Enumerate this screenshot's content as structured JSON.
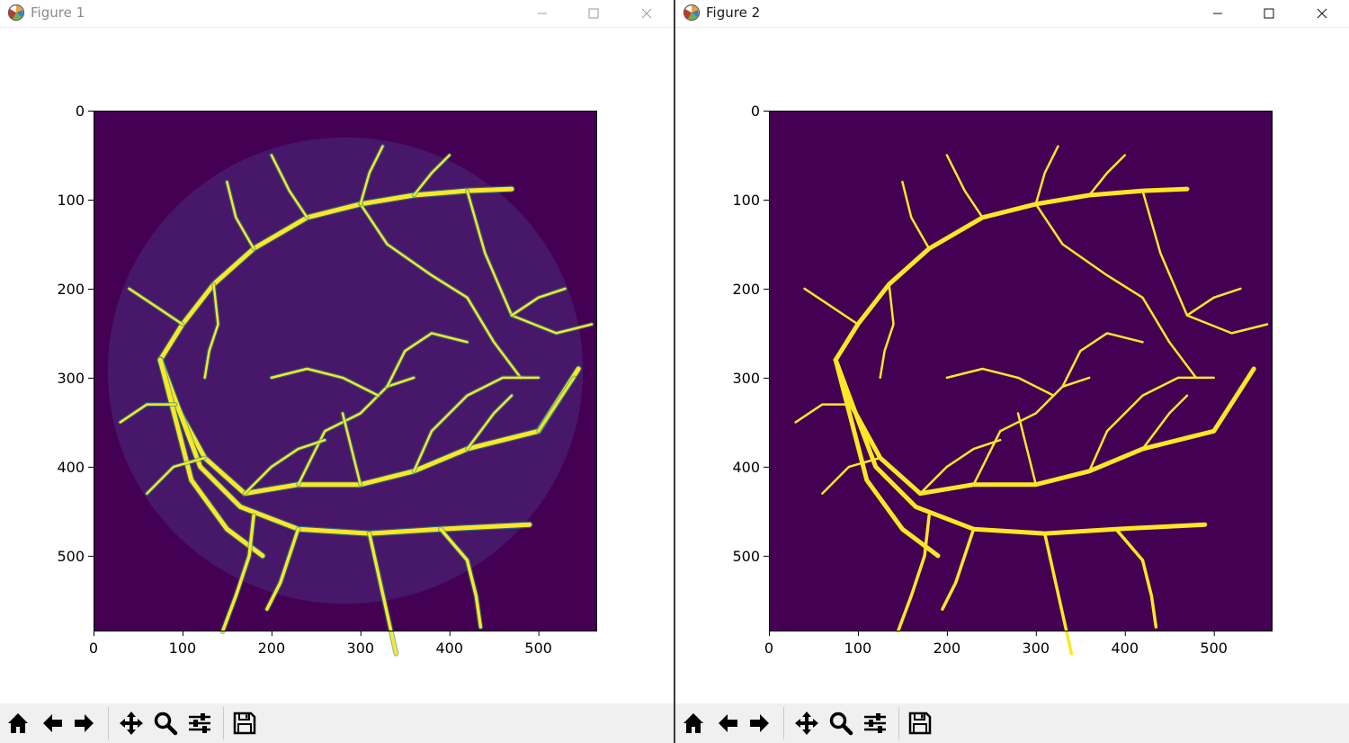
{
  "windows": [
    {
      "title": "Figure 1",
      "image_style": "probability-map",
      "chart_data": {
        "type": "heatmap",
        "title": "",
        "xlabel": "",
        "ylabel": "",
        "image_shape": [
          584,
          565
        ],
        "xlim": [
          0,
          565
        ],
        "ylim": [
          584,
          0
        ],
        "xticks": [
          0,
          100,
          200,
          300,
          400,
          500
        ],
        "yticks": [
          0,
          100,
          200,
          300,
          400,
          500
        ],
        "colormap": "viridis",
        "colors": {
          "background": "#440154",
          "mid": "#21918c",
          "high": "#fde725"
        }
      }
    },
    {
      "title": "Figure 2",
      "image_style": "binary-mask",
      "chart_data": {
        "type": "heatmap",
        "title": "",
        "xlabel": "",
        "ylabel": "",
        "image_shape": [
          584,
          565
        ],
        "xlim": [
          0,
          565
        ],
        "ylim": [
          584,
          0
        ],
        "xticks": [
          0,
          100,
          200,
          300,
          400,
          500
        ],
        "yticks": [
          0,
          100,
          200,
          300,
          400,
          500
        ],
        "colormap": "viridis",
        "colors": {
          "background": "#440154",
          "high": "#fde725"
        }
      }
    }
  ],
  "window_controls": [
    "minimize-icon",
    "maximize-icon",
    "close-icon"
  ],
  "toolbar_buttons": [
    {
      "name": "home-icon",
      "tooltip": "Reset original view"
    },
    {
      "name": "back-arrow-icon",
      "tooltip": "Back to previous view"
    },
    {
      "name": "forward-arrow-icon",
      "tooltip": "Forward to next view"
    },
    {
      "name": "pan-move-icon",
      "tooltip": "Pan axes"
    },
    {
      "name": "zoom-magnifier-icon",
      "tooltip": "Zoom to rectangle"
    },
    {
      "name": "configure-subplots-icon",
      "tooltip": "Configure subplots"
    },
    {
      "name": "save-floppy-icon",
      "tooltip": "Save the figure"
    }
  ],
  "vessels": [
    [
      [
        75,
        280
      ],
      [
        100,
        240
      ],
      [
        135,
        195
      ],
      [
        180,
        155
      ],
      [
        240,
        120
      ],
      [
        300,
        105
      ],
      [
        360,
        95
      ],
      [
        420,
        90
      ],
      [
        470,
        88
      ]
    ],
    [
      [
        75,
        280
      ],
      [
        92,
        330
      ],
      [
        125,
        390
      ],
      [
        170,
        430
      ],
      [
        230,
        420
      ],
      [
        300,
        420
      ],
      [
        360,
        405
      ],
      [
        420,
        380
      ],
      [
        500,
        360
      ],
      [
        545,
        290
      ]
    ],
    [
      [
        75,
        280
      ],
      [
        120,
        400
      ],
      [
        165,
        445
      ],
      [
        230,
        470
      ],
      [
        310,
        475
      ],
      [
        390,
        470
      ],
      [
        490,
        465
      ]
    ],
    [
      [
        75,
        280
      ],
      [
        110,
        415
      ],
      [
        150,
        470
      ],
      [
        190,
        500
      ]
    ],
    [
      [
        180,
        455
      ],
      [
        175,
        500
      ],
      [
        160,
        545
      ],
      [
        145,
        585
      ]
    ],
    [
      [
        230,
        470
      ],
      [
        210,
        530
      ],
      [
        195,
        560
      ]
    ],
    [
      [
        390,
        470
      ],
      [
        420,
        505
      ],
      [
        430,
        545
      ],
      [
        435,
        580
      ]
    ],
    [
      [
        310,
        475
      ],
      [
        320,
        520
      ],
      [
        330,
        565
      ],
      [
        340,
        610
      ]
    ],
    [
      [
        420,
        90
      ],
      [
        440,
        160
      ],
      [
        470,
        230
      ],
      [
        520,
        250
      ],
      [
        560,
        240
      ]
    ],
    [
      [
        300,
        105
      ],
      [
        330,
        150
      ],
      [
        380,
        185
      ],
      [
        420,
        210
      ],
      [
        450,
        260
      ],
      [
        480,
        300
      ]
    ],
    [
      [
        360,
        405
      ],
      [
        380,
        360
      ],
      [
        420,
        320
      ],
      [
        460,
        300
      ],
      [
        500,
        300
      ]
    ],
    [
      [
        230,
        420
      ],
      [
        260,
        360
      ],
      [
        300,
        340
      ],
      [
        330,
        310
      ],
      [
        360,
        300
      ]
    ],
    [
      [
        240,
        120
      ],
      [
        220,
        90
      ],
      [
        200,
        50
      ]
    ],
    [
      [
        300,
        105
      ],
      [
        310,
        70
      ],
      [
        325,
        40
      ]
    ],
    [
      [
        360,
        95
      ],
      [
        380,
        70
      ],
      [
        400,
        50
      ]
    ],
    [
      [
        180,
        155
      ],
      [
        160,
        120
      ],
      [
        150,
        80
      ]
    ],
    [
      [
        135,
        195
      ],
      [
        140,
        240
      ],
      [
        130,
        270
      ],
      [
        125,
        300
      ]
    ],
    [
      [
        100,
        240
      ],
      [
        70,
        220
      ],
      [
        40,
        200
      ]
    ],
    [
      [
        92,
        330
      ],
      [
        60,
        330
      ],
      [
        30,
        350
      ]
    ],
    [
      [
        125,
        390
      ],
      [
        90,
        400
      ],
      [
        60,
        430
      ]
    ],
    [
      [
        170,
        430
      ],
      [
        200,
        400
      ],
      [
        230,
        380
      ],
      [
        260,
        370
      ]
    ],
    [
      [
        300,
        420
      ],
      [
        290,
        380
      ],
      [
        280,
        340
      ]
    ],
    [
      [
        420,
        380
      ],
      [
        450,
        340
      ],
      [
        470,
        320
      ]
    ],
    [
      [
        330,
        310
      ],
      [
        350,
        270
      ],
      [
        380,
        250
      ],
      [
        420,
        260
      ]
    ],
    [
      [
        200,
        300
      ],
      [
        240,
        290
      ],
      [
        280,
        300
      ],
      [
        320,
        320
      ]
    ],
    [
      [
        470,
        230
      ],
      [
        500,
        210
      ],
      [
        530,
        200
      ]
    ],
    [
      [
        500,
        360
      ],
      [
        520,
        330
      ],
      [
        540,
        300
      ]
    ]
  ]
}
